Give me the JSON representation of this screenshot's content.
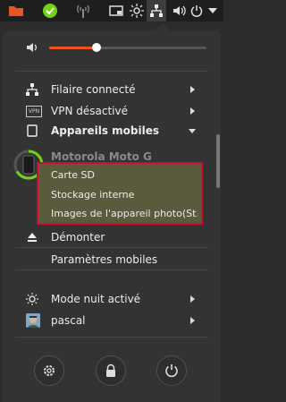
{
  "topbar": {
    "icons": [
      "folder-icon",
      "check-circle-icon",
      "antenna-icon",
      "window-icon",
      "brightness-icon",
      "network-icon",
      "speaker-icon",
      "power-icon",
      "chevron-down-icon"
    ]
  },
  "menu": {
    "wired": "Filaire connecté",
    "vpn": "VPN désactivé",
    "vpn_badge": "VPN",
    "mobile_devices": "Appareils mobiles",
    "device_name": "Motorola Moto G",
    "storage_items": [
      "Carte SD",
      "Stockage interne",
      "Images de l'appareil photo(St..."
    ],
    "unmount": "Démonter",
    "mobile_settings": "Paramètres mobiles",
    "night_mode": "Mode nuit activé",
    "user": "pascal"
  },
  "volume": {
    "level": 0.3
  },
  "colors": {
    "accent": "#e95420",
    "battery": "#73d216",
    "highlight_border": "#c8102e"
  }
}
